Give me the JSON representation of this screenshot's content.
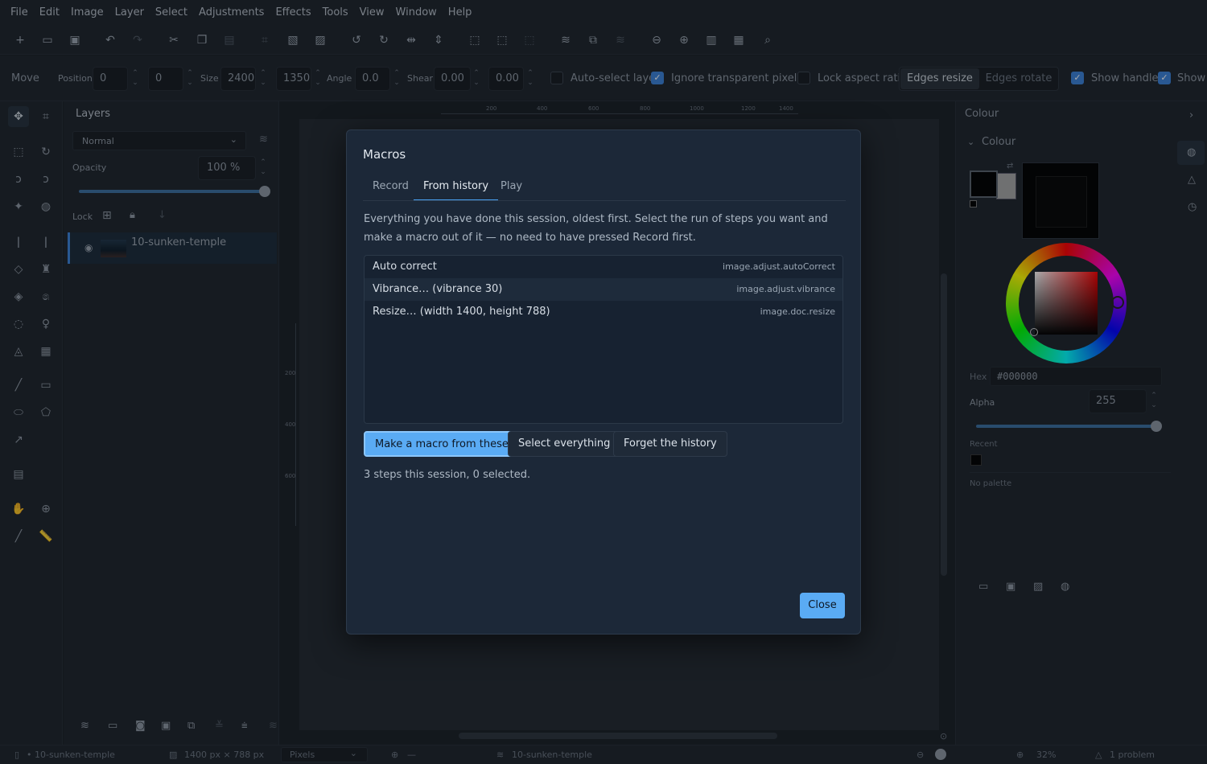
{
  "menu": [
    "File",
    "Edit",
    "Image",
    "Layer",
    "Select",
    "Adjustments",
    "Effects",
    "Tools",
    "View",
    "Window",
    "Help"
  ],
  "options": {
    "tool_name": "Move",
    "position_label": "Position",
    "pos_x": "0",
    "pos_y": "0",
    "size_label": "Size",
    "size_w": "2400",
    "size_h": "1350",
    "angle_label": "Angle",
    "angle": "0.0",
    "shear_label": "Shear",
    "shear_x": "0.00",
    "shear_y": "0.00",
    "auto_select": "Auto-select layer",
    "ignore_transparent": "Ignore transparent pixels",
    "lock_aspect": "Lock aspect ratio",
    "edges_resize": "Edges resize",
    "edges_rotate": "Edges rotate",
    "show_handles": "Show handles",
    "show_more": "Show"
  },
  "layers": {
    "title": "Layers",
    "blend_mode": "Normal",
    "opacity_label": "Opacity",
    "opacity_value": "100 %",
    "opacity_fraction": 1.0,
    "lock_label": "Lock",
    "layer_name": "10-sunken-temple"
  },
  "ruler": {
    "top_ticks": [
      "200",
      "400",
      "600",
      "800",
      "1000",
      "1200",
      "1400"
    ],
    "left_ticks": [
      "200",
      "400",
      "600"
    ]
  },
  "colour": {
    "panel_title": "Colour",
    "section_title": "Colour",
    "hex_label": "Hex",
    "hex_value": "#000000",
    "alpha_label": "Alpha",
    "alpha_value": "255",
    "recent_label": "Recent",
    "palette_label": "No palette",
    "primary_color": "#000000",
    "secondary_color": "#a7a7a7"
  },
  "dialog": {
    "title": "Macros",
    "tabs": [
      "Record",
      "From history",
      "Play"
    ],
    "active_tab": "From history",
    "description": "Everything you have done this session, oldest first. Select the run of steps you want and make a macro out of it — no need to have pressed Record first.",
    "steps": [
      {
        "label": "Auto correct",
        "command": "image.adjust.autoCorrect"
      },
      {
        "label": "Vibrance…  (vibrance 30)",
        "command": "image.adjust.vibrance"
      },
      {
        "label": "Resize…  (width 1400, height 788)",
        "command": "image.doc.resize"
      }
    ],
    "make_macro": "Make a macro from these",
    "select_all": "Select everything",
    "forget": "Forget the history",
    "count_text": "3 steps this session, 0 selected.",
    "close": "Close"
  },
  "status": {
    "doc": "• 10-sunken-temple",
    "dims": "1400 px × 788 px",
    "units": "Pixels",
    "cursor": "—",
    "layer": "10-sunken-temple",
    "zoom": "32%",
    "problems": "1 problem"
  }
}
